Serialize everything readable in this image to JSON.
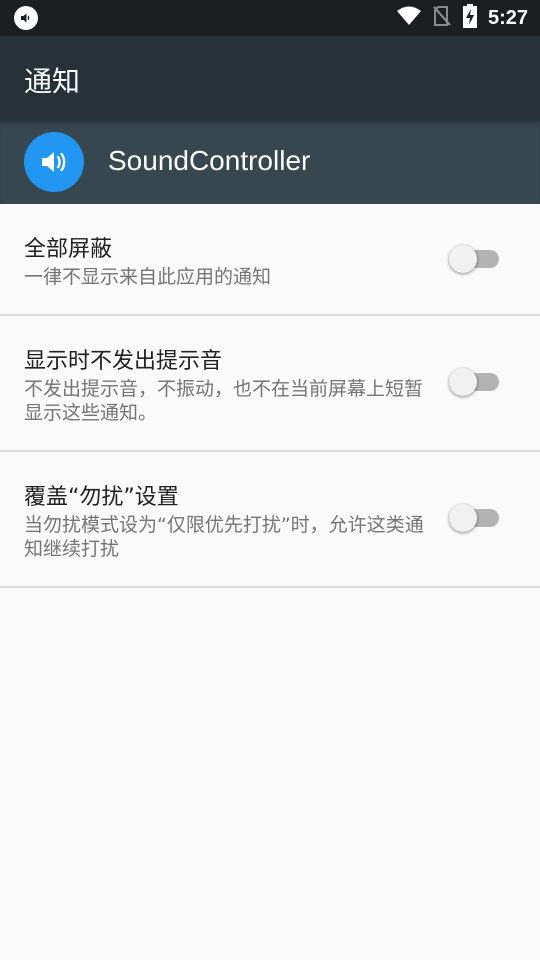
{
  "status_bar": {
    "time": "5:27",
    "icons": [
      "volume-notification-icon",
      "wifi-icon",
      "no-sim-icon",
      "battery-charging-icon"
    ]
  },
  "app_bar": {
    "title": "通知"
  },
  "app_header": {
    "app_name": "SoundController",
    "icon": "speaker-icon",
    "icon_color": "#2196f3"
  },
  "settings": [
    {
      "title": "全部屏蔽",
      "summary": "一律不显示来自此应用的通知",
      "enabled": false
    },
    {
      "title": "显示时不发出提示音",
      "summary": "不发出提示音，不振动，也不在当前屏幕上短暂显示这些通知。",
      "enabled": false
    },
    {
      "title": "覆盖“勿扰”设置",
      "summary": "当勿扰模式设为“仅限优先打扰”时，允许这类通知继续打扰",
      "enabled": false
    }
  ]
}
